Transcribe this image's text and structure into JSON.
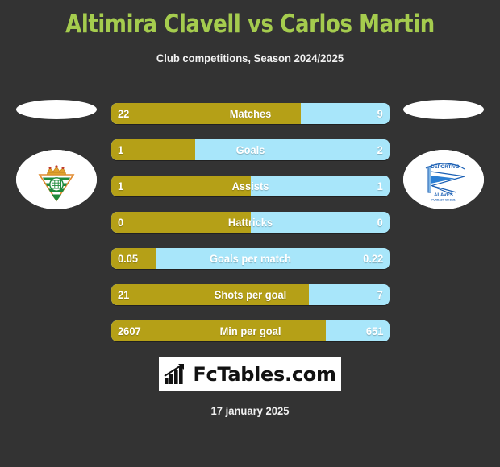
{
  "header": {
    "title": "Altimira Clavell vs Carlos Martin",
    "subtitle": "Club competitions, Season 2024/2025"
  },
  "teams": {
    "home": {
      "name": "Real Betis",
      "badge_icon": "real-betis-crest"
    },
    "away": {
      "name": "Deportivo Alaves",
      "badge_icon": "deportivo-alaves-crest"
    }
  },
  "footer": {
    "brand": "FcTables.com",
    "brand_icon": "bar-chart-growth-icon",
    "date": "17 january 2025"
  },
  "colors": {
    "background": "#333333",
    "title": "#a5cc4e",
    "home_bar": "#b5a017",
    "away_bar": "#a8e6fa",
    "text": "#ffffff"
  },
  "chart_data": {
    "type": "bar",
    "title": "Altimira Clavell vs Carlos Martin",
    "subtitle": "Club competitions, Season 2024/2025",
    "orientation": "horizontal-diverging",
    "legend_position": "none",
    "series": [
      {
        "name": "Altimira Clavell",
        "color": "#b5a017",
        "side": "left",
        "values": [
          22,
          1,
          1,
          0,
          0.05,
          21,
          2607
        ]
      },
      {
        "name": "Carlos Martin",
        "color": "#a8e6fa",
        "side": "right",
        "values": [
          9,
          2,
          1,
          0,
          0.22,
          7,
          651
        ]
      }
    ],
    "categories": [
      "Matches",
      "Goals",
      "Assists",
      "Hattricks",
      "Goals per match",
      "Shots per goal",
      "Min per goal"
    ],
    "rows": [
      {
        "label": "Matches",
        "home": "22",
        "away": "9",
        "home_pct": 68
      },
      {
        "label": "Goals",
        "home": "1",
        "away": "2",
        "home_pct": 30
      },
      {
        "label": "Assists",
        "home": "1",
        "away": "1",
        "home_pct": 50
      },
      {
        "label": "Hattricks",
        "home": "0",
        "away": "0",
        "home_pct": 50
      },
      {
        "label": "Goals per match",
        "home": "0.05",
        "away": "0.22",
        "home_pct": 16
      },
      {
        "label": "Shots per goal",
        "home": "21",
        "away": "7",
        "home_pct": 71
      },
      {
        "label": "Min per goal",
        "home": "2607",
        "away": "651",
        "home_pct": 77
      }
    ]
  }
}
